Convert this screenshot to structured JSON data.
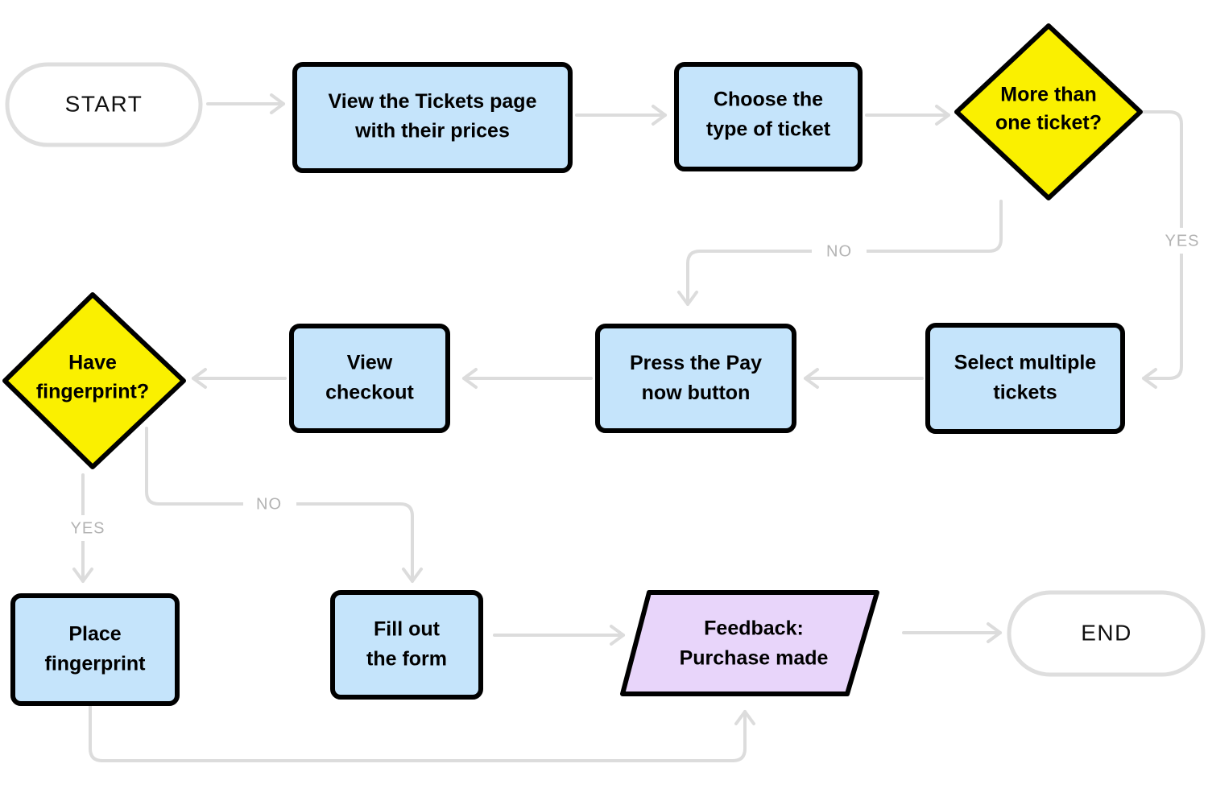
{
  "diagram": {
    "title": "Ticket purchase flowchart",
    "colors": {
      "process_fill": "#c5e4fb",
      "decision_fill": "#faf000",
      "io_fill": "#e8d5fa",
      "terminal_fill": "#ffffff",
      "terminal_stroke": "#dedede",
      "node_stroke": "#000000",
      "connector": "#dcdcdc",
      "label_text": "#b3b3b3",
      "background": "#ffffff"
    }
  },
  "nodes": {
    "start": {
      "label": "START",
      "type": "terminal"
    },
    "view_tickets": {
      "type": "process",
      "line1_a": "View the ",
      "line1_em": "Tickets",
      "line1_b": " page",
      "line2": "with their prices"
    },
    "choose_type": {
      "type": "process",
      "line1": "Choose the",
      "line2": "type of ticket"
    },
    "more_than_one": {
      "type": "decision",
      "line1": "More than",
      "line2": "one ticket?"
    },
    "select_multiple": {
      "type": "process",
      "line1": "Select multiple",
      "line2": "tickets"
    },
    "press_pay": {
      "type": "process",
      "line1_a": "Press the ",
      "line1_em": "Pay",
      "line2_em": "now",
      "line2_b": " button"
    },
    "view_checkout": {
      "type": "process",
      "line1": "View",
      "line2": "checkout"
    },
    "have_fingerprint": {
      "type": "decision",
      "line1": "Have",
      "line2": "fingerprint?"
    },
    "place_fingerprint": {
      "type": "process",
      "line1": "Place",
      "line2": "fingerprint"
    },
    "fill_form": {
      "type": "process",
      "line1": "Fill out",
      "line2": "the form"
    },
    "feedback": {
      "type": "io",
      "line1": "Feedback:",
      "line2": "Purchase made"
    },
    "end": {
      "label": "END",
      "type": "terminal"
    }
  },
  "edge_labels": {
    "more_than_one_no": "NO",
    "more_than_one_yes": "YES",
    "have_fingerprint_yes": "YES",
    "have_fingerprint_no": "NO"
  }
}
